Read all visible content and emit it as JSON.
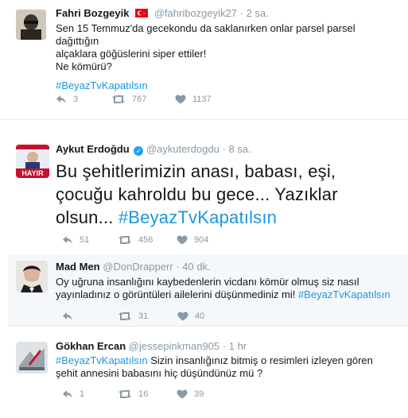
{
  "tweets": [
    {
      "name": "Fahri Bozgeyik",
      "handle": "@fahribozgeyik27",
      "time": "2 sa.",
      "flag": "turkey-flag",
      "line1": "Sen 15 Temmuz'da gecekondu da saklanırken onlar parsel parsel dağıttığın",
      "line2": "alçaklara göğüslerini siper ettiler!",
      "line3": "Ne kömürü?",
      "hashtag": "#BeyazTvKapatılsın",
      "replies": "3",
      "retweets": "767",
      "likes": "1137"
    },
    {
      "name": "Aykut Erdoğdu",
      "handle": "@aykuterdogdu",
      "time": "8 sa.",
      "avatar_text": "HAYIR",
      "line1": "Bu şehitlerimizin anası, babası, eşi,",
      "line2": "çocuğu kahroldu bu gece... Yazıklar",
      "line3": "olsun...",
      "hashtag": "#BeyazTvKapatılsın",
      "replies": "51",
      "retweets": "456",
      "likes": "904"
    },
    {
      "name": "Mad Men",
      "handle": "@DonDrapperr",
      "time": "40 dk.",
      "line1": "Oy uğruna insanlığını kaybedenlerin vicdanı kömür olmuş siz nasıl",
      "line2": "yayınladınız o görüntüleri ailelerini düşünmediniz mi!",
      "hashtag": "#BeyazTvKapatılsın",
      "replies": "",
      "retweets": "31",
      "likes": "40"
    },
    {
      "name": "Gökhan Ercan",
      "handle": "@jessepinkman905",
      "time": "1 hr",
      "hashtag": "#BeyazTvKapatılsın",
      "line1": "Sizin insanlığınız bitmiş o resimleri izleyen gören",
      "line2": "şehit  annesini babasını hiç düşündünüz mü ?",
      "replies": "1",
      "retweets": "16",
      "likes": "39"
    }
  ],
  "colors": {
    "hashtag": "#1b95e0",
    "muted": "#8899a6",
    "verified": "#1da1f2"
  },
  "icons": [
    "reply-icon",
    "retweet-icon",
    "like-icon",
    "verified-icon"
  ]
}
